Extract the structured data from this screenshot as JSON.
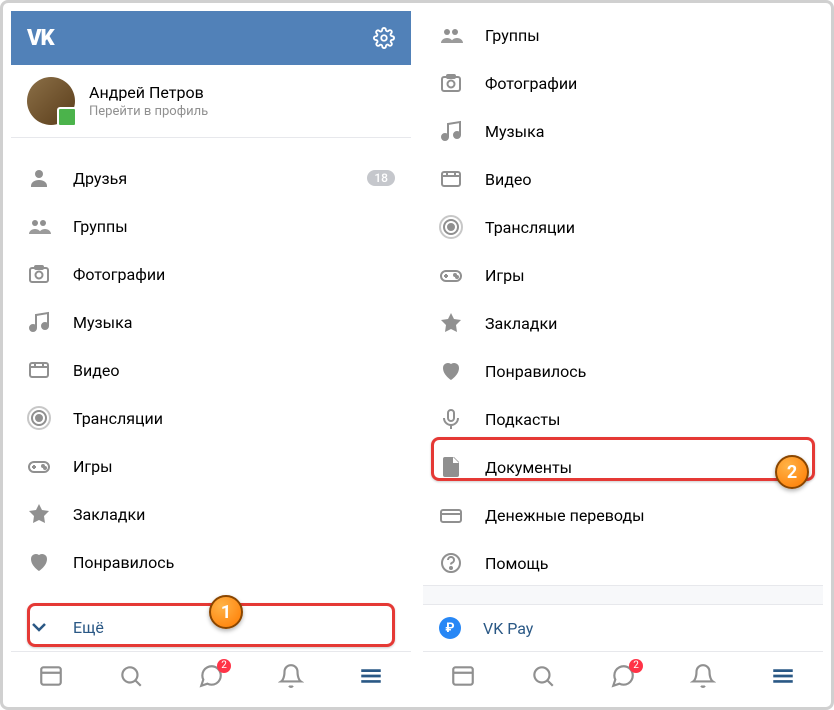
{
  "left": {
    "profile": {
      "name": "Андрей Петров",
      "sub": "Перейти в профиль"
    },
    "menu": [
      {
        "icon": "friends",
        "label": "Друзья",
        "badge": "18"
      },
      {
        "icon": "groups",
        "label": "Группы"
      },
      {
        "icon": "photos",
        "label": "Фотографии"
      },
      {
        "icon": "music",
        "label": "Музыка"
      },
      {
        "icon": "video",
        "label": "Видео"
      },
      {
        "icon": "live",
        "label": "Трансляции"
      },
      {
        "icon": "games",
        "label": "Игры"
      },
      {
        "icon": "bookmarks",
        "label": "Закладки"
      },
      {
        "icon": "liked",
        "label": "Понравилось"
      }
    ],
    "more": "Ещё",
    "nav_badge": "2"
  },
  "right": {
    "menu": [
      {
        "icon": "groups",
        "label": "Группы"
      },
      {
        "icon": "photos",
        "label": "Фотографии"
      },
      {
        "icon": "music",
        "label": "Музыка"
      },
      {
        "icon": "video",
        "label": "Видео"
      },
      {
        "icon": "live",
        "label": "Трансляции"
      },
      {
        "icon": "games",
        "label": "Игры"
      },
      {
        "icon": "bookmarks",
        "label": "Закладки"
      },
      {
        "icon": "liked",
        "label": "Понравилось"
      },
      {
        "icon": "podcasts",
        "label": "Подкасты"
      },
      {
        "icon": "documents",
        "label": "Документы"
      },
      {
        "icon": "money",
        "label": "Денежные переводы"
      },
      {
        "icon": "help",
        "label": "Помощь"
      }
    ],
    "vkpay": "VK Pay",
    "vkpay_symbol": "₽",
    "nav_badge": "2"
  },
  "markers": {
    "one": "1",
    "two": "2"
  }
}
